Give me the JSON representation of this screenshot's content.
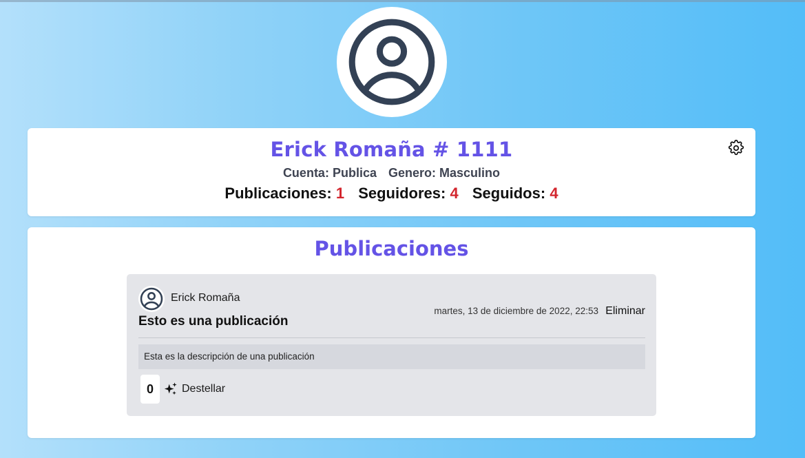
{
  "profile": {
    "name": "Erick Romaña # 1111",
    "account_label": "Cuenta:",
    "account_value": "Publica",
    "gender_label": "Genero:",
    "gender_value": "Masculino",
    "stats": [
      {
        "label": "Publicaciones:",
        "value": "1"
      },
      {
        "label": "Seguidores:",
        "value": "4"
      },
      {
        "label": "Seguidos:",
        "value": "4"
      }
    ],
    "settings_icon": "gear-icon",
    "avatar_icon": "user-circle-icon"
  },
  "posts_section": {
    "title": "Publicaciones",
    "posts": [
      {
        "author": "Erick Romaña",
        "title": "Esto es una publicación",
        "date": "martes, 13 de diciembre de 2022, 22:53",
        "delete_label": "Eliminar",
        "description": "Esta es la descripción de una publicación",
        "sparkle_count": "0",
        "sparkle_label": "Destellar",
        "sparkle_icon": "sparkles-icon"
      }
    ]
  },
  "colors": {
    "accent": "#6453e6",
    "stat_value": "#d3262e",
    "icon": "#334155",
    "background_start": "#b3e0fb",
    "background_end": "#53bdf8"
  }
}
